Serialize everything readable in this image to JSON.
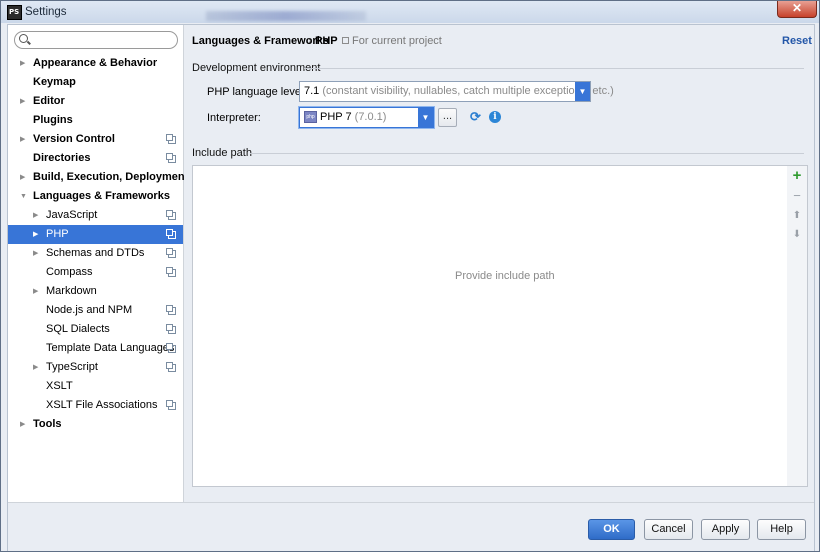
{
  "window": {
    "title": "Settings",
    "close_glyph": "✕"
  },
  "search": {
    "placeholder": ""
  },
  "sidebar": {
    "items": [
      {
        "label": "Appearance & Behavior",
        "bold": true,
        "arrow": "▶",
        "indent": 0,
        "project": false
      },
      {
        "label": "Keymap",
        "bold": true,
        "arrow": "",
        "indent": 0,
        "project": false
      },
      {
        "label": "Editor",
        "bold": true,
        "arrow": "▶",
        "indent": 0,
        "project": false
      },
      {
        "label": "Plugins",
        "bold": true,
        "arrow": "",
        "indent": 0,
        "project": false
      },
      {
        "label": "Version Control",
        "bold": true,
        "arrow": "▶",
        "indent": 0,
        "project": true
      },
      {
        "label": "Directories",
        "bold": true,
        "arrow": "",
        "indent": 0,
        "project": true
      },
      {
        "label": "Build, Execution, Deployment",
        "bold": true,
        "arrow": "▶",
        "indent": 0,
        "project": false
      },
      {
        "label": "Languages & Frameworks",
        "bold": true,
        "arrow": "▼",
        "indent": 0,
        "project": false
      },
      {
        "label": "JavaScript",
        "bold": false,
        "arrow": "▶",
        "indent": 1,
        "project": true
      },
      {
        "label": "PHP",
        "bold": false,
        "arrow": "▶",
        "indent": 1,
        "project": true,
        "selected": true
      },
      {
        "label": "Schemas and DTDs",
        "bold": false,
        "arrow": "▶",
        "indent": 1,
        "project": true
      },
      {
        "label": "Compass",
        "bold": false,
        "arrow": "",
        "indent": 1,
        "project": true
      },
      {
        "label": "Markdown",
        "bold": false,
        "arrow": "▶",
        "indent": 1,
        "project": false
      },
      {
        "label": "Node.js and NPM",
        "bold": false,
        "arrow": "",
        "indent": 1,
        "project": true
      },
      {
        "label": "SQL Dialects",
        "bold": false,
        "arrow": "",
        "indent": 1,
        "project": true
      },
      {
        "label": "Template Data Languages",
        "bold": false,
        "arrow": "",
        "indent": 1,
        "project": true
      },
      {
        "label": "TypeScript",
        "bold": false,
        "arrow": "▶",
        "indent": 1,
        "project": true
      },
      {
        "label": "XSLT",
        "bold": false,
        "arrow": "",
        "indent": 1,
        "project": false
      },
      {
        "label": "XSLT File Associations",
        "bold": false,
        "arrow": "",
        "indent": 1,
        "project": true
      },
      {
        "label": "Tools",
        "bold": true,
        "arrow": "▶",
        "indent": 0,
        "project": false
      }
    ]
  },
  "breadcrumb": {
    "parent": "Languages & Frameworks",
    "separator": "›",
    "current": "PHP",
    "scope_note": "For current project"
  },
  "reset_label": "Reset",
  "dev_env": {
    "group_label": "Development environment",
    "level_label": "PHP language level:",
    "level_value": "7.1",
    "level_detail": "(constant visibility, nullables, catch multiple exceptions, etc.)",
    "interpreter_label": "Interpreter:",
    "interpreter_value": "PHP 7",
    "interpreter_version": "(7.0.1)",
    "interpreter_badge": "php",
    "browse_label": "...",
    "combo_arrow": "▼"
  },
  "include_path": {
    "group_label": "Include path",
    "empty_text": "Provide include path",
    "toolbar": {
      "add": "+",
      "remove": "−",
      "up": "⬆",
      "down": "⬇"
    }
  },
  "footer": {
    "ok": "OK",
    "cancel": "Cancel",
    "apply": "Apply",
    "help": "Help"
  },
  "colors": {
    "selection": "#3875d7",
    "link": "#2457a8",
    "add": "#2e9b2e"
  }
}
